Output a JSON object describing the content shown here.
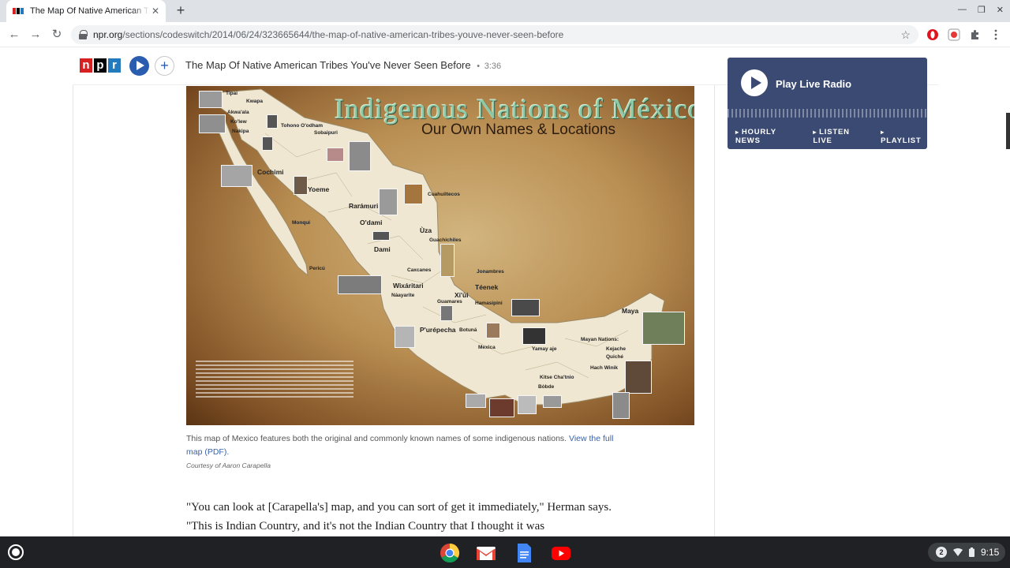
{
  "browser": {
    "tab_title": "The Map Of Native American Tribes You've Never Seen Before",
    "tab_close": "✕",
    "new_tab": "+",
    "url_domain": "npr.org",
    "url_path": "/sections/codeswitch/2014/06/24/323665644/the-map-of-native-american-tribes-youve-never-seen-before",
    "back": "←",
    "forward": "→",
    "reload": "↻",
    "star": "☆",
    "win_min": "—",
    "win_max": "❐",
    "win_close": "✕"
  },
  "npr_header": {
    "logo": [
      "n",
      "p",
      "r"
    ],
    "plus": "+",
    "story_title": "The Map Of Native American Tribes You've Never Seen Before",
    "separator": "•",
    "duration": "3:36"
  },
  "radio": {
    "label": "Play Live Radio",
    "links": [
      "HOURLY NEWS",
      "LISTEN LIVE",
      "PLAYLIST"
    ]
  },
  "map": {
    "title": "Indigenous Nations of México",
    "subtitle": "Our Own Names & Locations",
    "labels": {
      "tipai": "Tipai",
      "kwapa": "Kwapa",
      "akwaala": "Akwa'ala",
      "koiaw": "Ko'lew",
      "nakipa": "Nakipa",
      "tohono": "Tohono O'odham",
      "sobaipuri": "Sobaipuri",
      "cochimi": "Cochimi",
      "yoeme": "Yoeme",
      "raramuri": "Rarámuri",
      "odami": "O'dami",
      "cuahuiltecos": "Cuahuiltecos",
      "uza": "Ùza",
      "guachichiles": "Guachichiles",
      "dami": "Dami",
      "wixaritari": "Wixáritari",
      "naayarite": "Náayarite",
      "teenek": "Téenek",
      "xiui": "Xi'ùi",
      "guamares": "Guamares",
      "purepecha": "P'urépecha",
      "botuna": "Botuná",
      "maya": "Maya",
      "mayan_nations": "Mayan Nations:",
      "yamay_aje": "Yamay aje",
      "kitse": "Kitse Cha'tnio",
      "monqui": "Monqui",
      "pericu": "Pericú",
      "jonambres": "Jonambres",
      "caxcanes": "Caxcanes",
      "hamasipini": "Hamasipini",
      "mexica": "Mexica",
      "bobde": "Bòbde",
      "kejache": "Kejache",
      "quiche": "Quiché",
      "hach_winik": "Hach Winik"
    }
  },
  "caption": {
    "text": "This map of Mexico features both the original and commonly known names of some indigenous nations.",
    "link": "View the full map (PDF).",
    "credit": "Courtesy of Aaron Carapella"
  },
  "body": {
    "paragraph": "\"You can look at [Carapella's] map, and you can sort of get it immediately,\" Herman says. \"This is Indian Country, and it's not the Indian Country that I thought it was"
  },
  "shelf": {
    "notification_count": "2",
    "time": "9:15"
  },
  "colors": {
    "npr_red": "#d62021",
    "npr_black": "#000000",
    "npr_blue": "#237bbd",
    "radio_bg": "#3b4a72",
    "link": "#3a62a8"
  }
}
